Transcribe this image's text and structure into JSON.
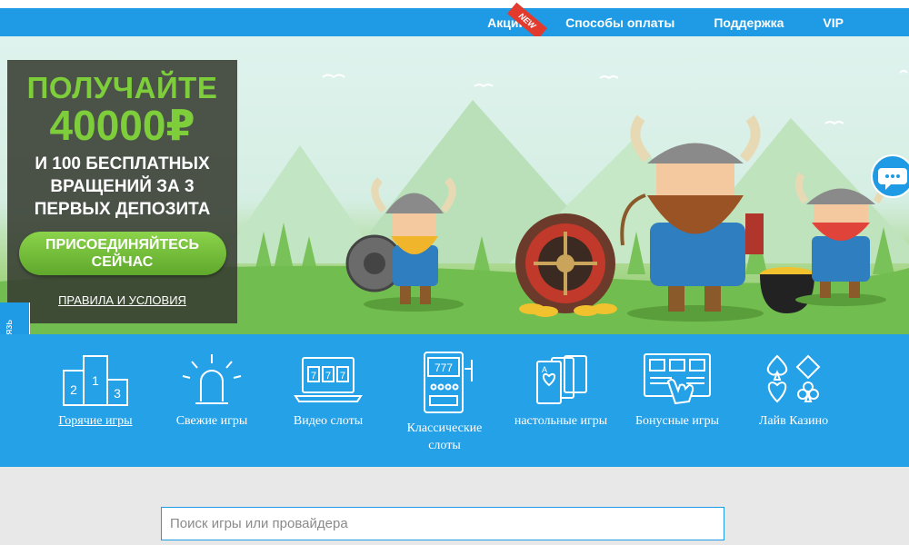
{
  "topnav": {
    "items": [
      "Акции",
      "Способы оплаты",
      "Поддержка",
      "VIP"
    ],
    "badge": "NEW"
  },
  "promo": {
    "line1": "ПОЛУЧАЙТЕ",
    "line2": "40000₽",
    "line3": "И 100 БЕСПЛАТНЫХ ВРАЩЕНИЙ ЗА 3 ПЕРВЫХ ДЕПОЗИТА",
    "cta": "ПРИСОЕДИНЯЙТЕСЬ СЕЙЧАС",
    "terms": "ПРАВИЛА И УСЛОВИЯ"
  },
  "feedback": "Обратная связь",
  "categories": [
    {
      "label": "Горячие игры",
      "icon": "podium-icon"
    },
    {
      "label": "Свежие игры",
      "icon": "siren-icon"
    },
    {
      "label": "Видео слоты",
      "icon": "laptop-slot-icon"
    },
    {
      "label": "Классические слоты",
      "icon": "slot-machine-icon"
    },
    {
      "label": "настольные игры",
      "icon": "playing-cards-icon"
    },
    {
      "label": "Бонусные игры",
      "icon": "bonus-hand-icon"
    },
    {
      "label": "Лайв Казино",
      "icon": "card-suits-icon"
    }
  ],
  "search": {
    "placeholder": "Поиск игры или провайдера"
  },
  "colors": {
    "brand": "#1e9be4",
    "accent_green": "#7dce3a",
    "badge_red": "#e23b2e"
  }
}
